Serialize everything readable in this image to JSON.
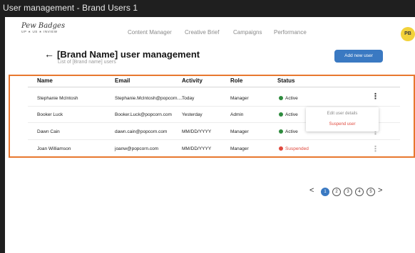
{
  "window": {
    "title": "User management - Brand Users 1"
  },
  "logo": {
    "script": "Pew Badges",
    "tagline": "UP ∗ US ∗ INVIEW"
  },
  "nav": [
    "Content Manager",
    "Creative Brief",
    "Campaigns",
    "Performance"
  ],
  "user": {
    "initials": "PB"
  },
  "header": {
    "title": "[Brand Name] user management",
    "subtitle": "List of [Brand name] users",
    "add_button": "Add new user"
  },
  "table": {
    "columns": [
      "Name",
      "Email",
      "Activity",
      "Role",
      "Status"
    ],
    "rows": [
      {
        "name": "Stephanie McIntosh",
        "email": "Stephanie.McIntosh@popcorn....",
        "activity": "Today",
        "role": "Manager",
        "status": "Active"
      },
      {
        "name": "Booker Luck",
        "email": "Booker.Luck@popcorn.com",
        "activity": "Yesterday",
        "role": "Admin",
        "status": "Active"
      },
      {
        "name": "Dawn Cain",
        "email": "dawn.cain@popcorn.com",
        "activity": "MM/DD/YYYY",
        "role": "Manager",
        "status": "Active"
      },
      {
        "name": "Joan Williamson",
        "email": "joanw@popcorn.com",
        "activity": "MM/DD/YYYY",
        "role": "Manager",
        "status": "Suspended"
      }
    ]
  },
  "row_menu": {
    "edit": "Edit user details",
    "suspend": "Suspend user"
  },
  "pagination": {
    "prev": "<",
    "next": ">",
    "pages": [
      "1",
      "2",
      "3",
      "4",
      "5"
    ],
    "current": "1"
  },
  "colors": {
    "accent": "#3a79c2",
    "highlight": "#e8772e",
    "active": "#2e8b3e",
    "suspended": "#e04a3f",
    "avatar": "#f2d23a"
  }
}
